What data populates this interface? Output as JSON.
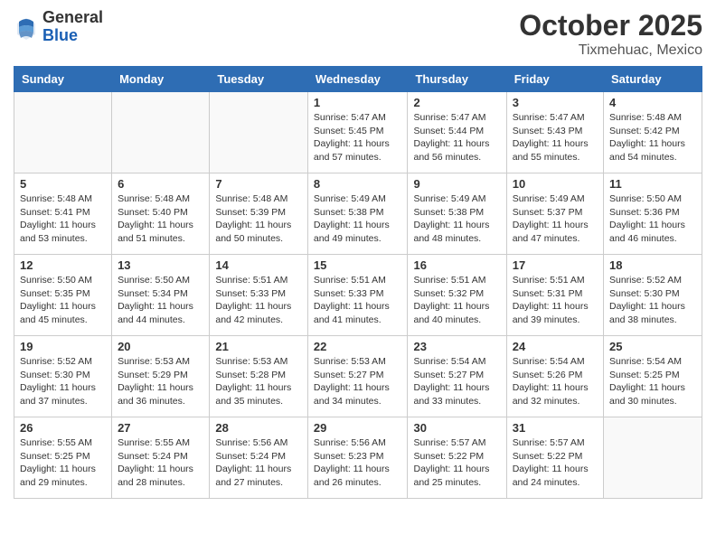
{
  "header": {
    "logo": {
      "general": "General",
      "blue": "Blue"
    },
    "month": "October 2025",
    "location": "Tixmehuac, Mexico"
  },
  "weekdays": [
    "Sunday",
    "Monday",
    "Tuesday",
    "Wednesday",
    "Thursday",
    "Friday",
    "Saturday"
  ],
  "weeks": [
    [
      {
        "day": null
      },
      {
        "day": null
      },
      {
        "day": null
      },
      {
        "day": "1",
        "sunrise": "5:47 AM",
        "sunset": "5:45 PM",
        "daylight": "11 hours and 57 minutes."
      },
      {
        "day": "2",
        "sunrise": "5:47 AM",
        "sunset": "5:44 PM",
        "daylight": "11 hours and 56 minutes."
      },
      {
        "day": "3",
        "sunrise": "5:47 AM",
        "sunset": "5:43 PM",
        "daylight": "11 hours and 55 minutes."
      },
      {
        "day": "4",
        "sunrise": "5:48 AM",
        "sunset": "5:42 PM",
        "daylight": "11 hours and 54 minutes."
      }
    ],
    [
      {
        "day": "5",
        "sunrise": "5:48 AM",
        "sunset": "5:41 PM",
        "daylight": "11 hours and 53 minutes."
      },
      {
        "day": "6",
        "sunrise": "5:48 AM",
        "sunset": "5:40 PM",
        "daylight": "11 hours and 51 minutes."
      },
      {
        "day": "7",
        "sunrise": "5:48 AM",
        "sunset": "5:39 PM",
        "daylight": "11 hours and 50 minutes."
      },
      {
        "day": "8",
        "sunrise": "5:49 AM",
        "sunset": "5:38 PM",
        "daylight": "11 hours and 49 minutes."
      },
      {
        "day": "9",
        "sunrise": "5:49 AM",
        "sunset": "5:38 PM",
        "daylight": "11 hours and 48 minutes."
      },
      {
        "day": "10",
        "sunrise": "5:49 AM",
        "sunset": "5:37 PM",
        "daylight": "11 hours and 47 minutes."
      },
      {
        "day": "11",
        "sunrise": "5:50 AM",
        "sunset": "5:36 PM",
        "daylight": "11 hours and 46 minutes."
      }
    ],
    [
      {
        "day": "12",
        "sunrise": "5:50 AM",
        "sunset": "5:35 PM",
        "daylight": "11 hours and 45 minutes."
      },
      {
        "day": "13",
        "sunrise": "5:50 AM",
        "sunset": "5:34 PM",
        "daylight": "11 hours and 44 minutes."
      },
      {
        "day": "14",
        "sunrise": "5:51 AM",
        "sunset": "5:33 PM",
        "daylight": "11 hours and 42 minutes."
      },
      {
        "day": "15",
        "sunrise": "5:51 AM",
        "sunset": "5:33 PM",
        "daylight": "11 hours and 41 minutes."
      },
      {
        "day": "16",
        "sunrise": "5:51 AM",
        "sunset": "5:32 PM",
        "daylight": "11 hours and 40 minutes."
      },
      {
        "day": "17",
        "sunrise": "5:51 AM",
        "sunset": "5:31 PM",
        "daylight": "11 hours and 39 minutes."
      },
      {
        "day": "18",
        "sunrise": "5:52 AM",
        "sunset": "5:30 PM",
        "daylight": "11 hours and 38 minutes."
      }
    ],
    [
      {
        "day": "19",
        "sunrise": "5:52 AM",
        "sunset": "5:30 PM",
        "daylight": "11 hours and 37 minutes."
      },
      {
        "day": "20",
        "sunrise": "5:53 AM",
        "sunset": "5:29 PM",
        "daylight": "11 hours and 36 minutes."
      },
      {
        "day": "21",
        "sunrise": "5:53 AM",
        "sunset": "5:28 PM",
        "daylight": "11 hours and 35 minutes."
      },
      {
        "day": "22",
        "sunrise": "5:53 AM",
        "sunset": "5:27 PM",
        "daylight": "11 hours and 34 minutes."
      },
      {
        "day": "23",
        "sunrise": "5:54 AM",
        "sunset": "5:27 PM",
        "daylight": "11 hours and 33 minutes."
      },
      {
        "day": "24",
        "sunrise": "5:54 AM",
        "sunset": "5:26 PM",
        "daylight": "11 hours and 32 minutes."
      },
      {
        "day": "25",
        "sunrise": "5:54 AM",
        "sunset": "5:25 PM",
        "daylight": "11 hours and 30 minutes."
      }
    ],
    [
      {
        "day": "26",
        "sunrise": "5:55 AM",
        "sunset": "5:25 PM",
        "daylight": "11 hours and 29 minutes."
      },
      {
        "day": "27",
        "sunrise": "5:55 AM",
        "sunset": "5:24 PM",
        "daylight": "11 hours and 28 minutes."
      },
      {
        "day": "28",
        "sunrise": "5:56 AM",
        "sunset": "5:24 PM",
        "daylight": "11 hours and 27 minutes."
      },
      {
        "day": "29",
        "sunrise": "5:56 AM",
        "sunset": "5:23 PM",
        "daylight": "11 hours and 26 minutes."
      },
      {
        "day": "30",
        "sunrise": "5:57 AM",
        "sunset": "5:22 PM",
        "daylight": "11 hours and 25 minutes."
      },
      {
        "day": "31",
        "sunrise": "5:57 AM",
        "sunset": "5:22 PM",
        "daylight": "11 hours and 24 minutes."
      },
      {
        "day": null
      }
    ]
  ]
}
